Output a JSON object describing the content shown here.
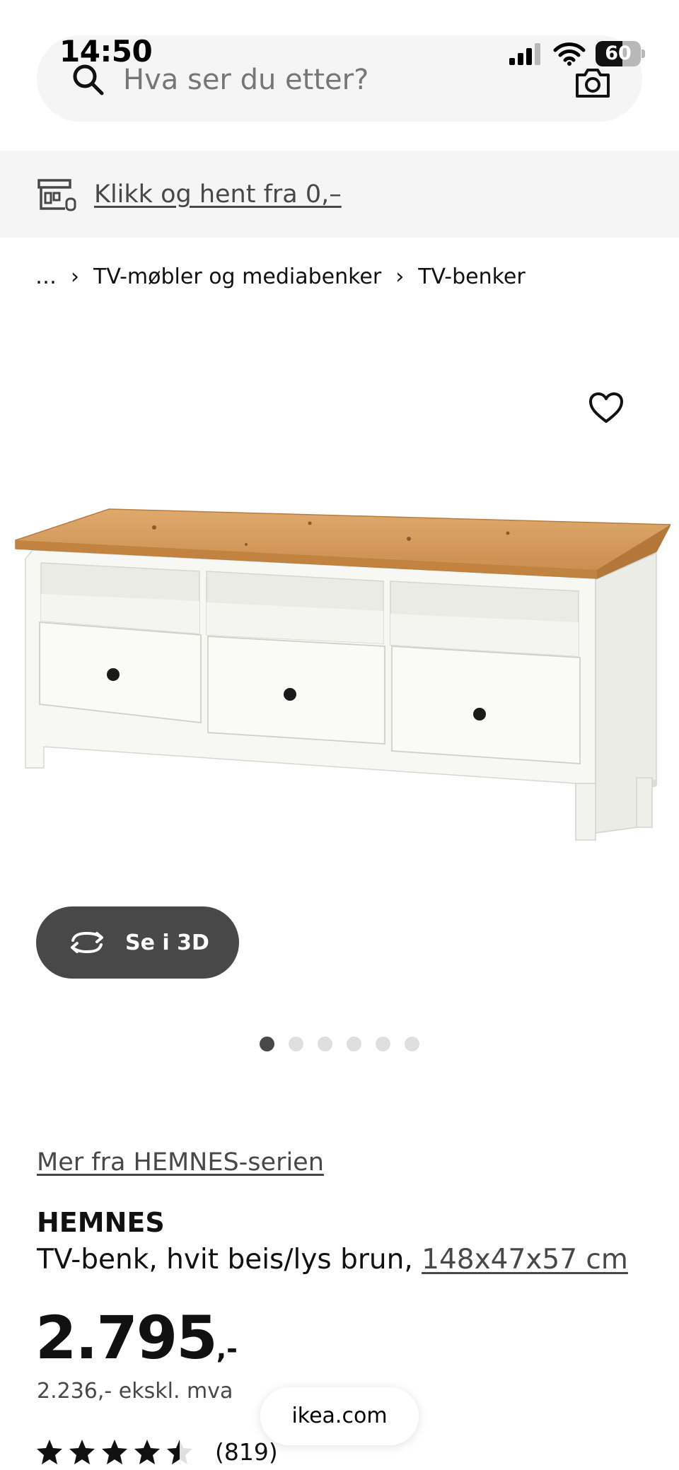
{
  "status_bar": {
    "time": "14:50",
    "battery_level": "60",
    "battery_fraction": 0.6
  },
  "search": {
    "placeholder": "Hva ser du etter?",
    "icon": "search-icon",
    "camera_icon": "camera-icon"
  },
  "store_banner": {
    "icon": "store-icon",
    "link_label": "Klikk og hent fra 0,–"
  },
  "breadcrumb": {
    "items": [
      "…",
      "TV-møbler og mediabenker",
      "TV-benker"
    ],
    "separator": "›"
  },
  "gallery": {
    "favorite_icon": "heart-icon",
    "view_3d_label": "Se i 3D",
    "dots_total": 6,
    "active_dot": 0
  },
  "product": {
    "series_link": "Mer fra HEMNES-serien",
    "name": "HEMNES",
    "description": "TV-benk, hvit beis/lys brun, ",
    "dimensions": "148x47x57 cm",
    "price_main": "2.795",
    "price_suffix": ",-",
    "price_ex_vat": "2.236,- ekskl. mva",
    "rating": 4.5,
    "rating_max": 5,
    "review_count": "(819)"
  },
  "browser": {
    "domain": "ikea.com"
  },
  "colors": {
    "accent_dark": "#484848",
    "wood": "#d49a5c",
    "light_bg": "#f5f5f5"
  }
}
